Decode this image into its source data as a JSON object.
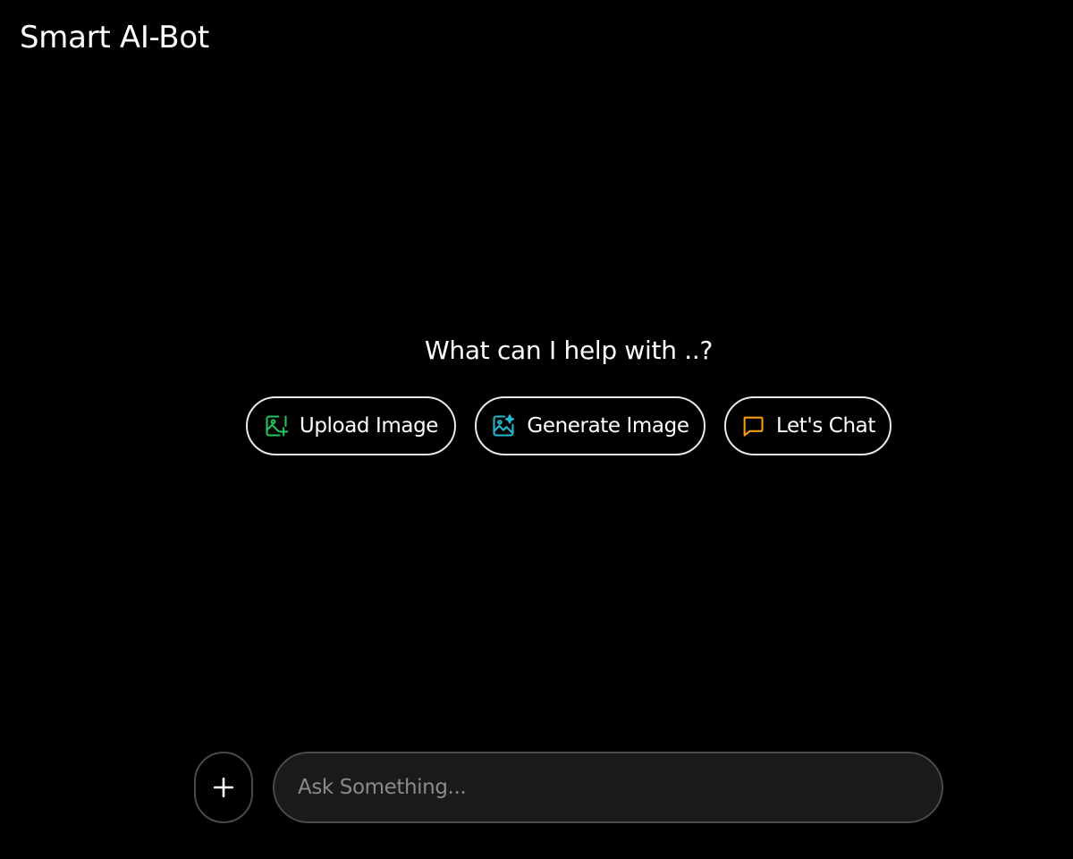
{
  "header": {
    "title": "Smart AI-Bot"
  },
  "main": {
    "prompt": "What can I help with ..?",
    "actions": [
      {
        "label": "Upload Image",
        "icon": "image-plus-icon",
        "icon_color": "#22c55e"
      },
      {
        "label": "Generate Image",
        "icon": "image-sparkle-icon",
        "icon_color": "#22b8cf"
      },
      {
        "label": "Let's Chat",
        "icon": "chat-bubble-icon",
        "icon_color": "#f59e0b"
      }
    ]
  },
  "composer": {
    "add_icon": "plus-icon",
    "input_value": "",
    "input_placeholder": "Ask Something..."
  },
  "colors": {
    "background": "#000000",
    "text": "#ffffff",
    "pill_border": "#e8e8e8",
    "input_background": "#1a1a1a",
    "input_border": "#4a4a4a",
    "placeholder": "#8a8a8a"
  }
}
